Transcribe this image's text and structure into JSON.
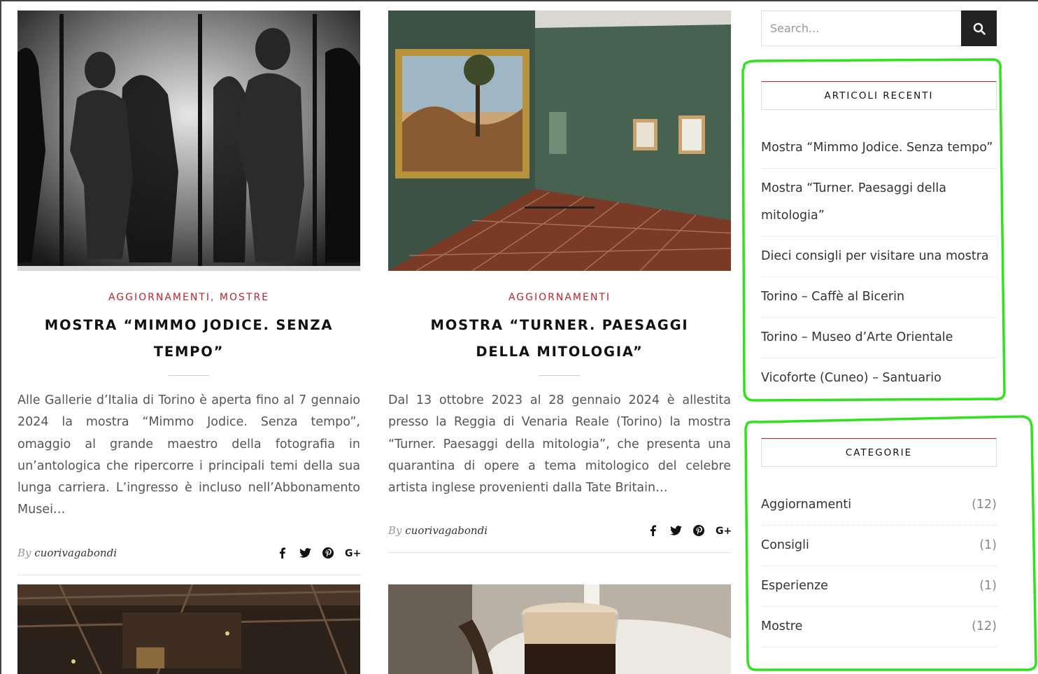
{
  "posts": [
    {
      "image_alt": "bronze-runners-photo",
      "categories": [
        "AGGIORNAMENTI",
        "MOSTRE"
      ],
      "category_separator": ",",
      "title": "MOSTRA “MIMMO JODICE. SENZA TEMPO”",
      "excerpt": "Alle Gallerie d’Italia di Torino è aperta fino al 7 gennaio 2024 la mostra “Mimmo Jodice. Senza tempo”, omaggio al grande maestro della fotografia in un’antologica che ripercorre i principali temi della sua lunga carriera. L’ingresso è incluso nell’Abbonamento Musei…",
      "by": "By",
      "author": "cuorivagabondi"
    },
    {
      "image_alt": "turner-gallery-photo",
      "categories": [
        "AGGIORNAMENTI"
      ],
      "category_separator": "",
      "title": "MOSTRA “TURNER. PAESAGGI DELLA MITOLOGIA”",
      "excerpt": "Dal 13 ottobre 2023 al 28 gennaio 2024 è allestita presso la Reggia di Venaria Reale (Torino) la mostra “Turner. Paesaggi della mitologia”, che presenta una quarantina di opere a tema mitologico del celebre artista inglese provenienti dalla Tate Britain…",
      "by": "By",
      "author": "cuorivagabondi"
    }
  ],
  "share_icons": [
    "facebook-icon",
    "twitter-icon",
    "pinterest-icon",
    "google-plus-icon"
  ],
  "search": {
    "placeholder": "Search..."
  },
  "recent": {
    "title": "ARTICOLI RECENTI",
    "items": [
      "Mostra “Mimmo Jodice. Senza tempo”",
      "Mostra “Turner. Paesaggi della mitologia”",
      "Dieci consigli per visitare una mostra",
      "Torino – Caffè al Bicerin",
      "Torino – Museo d’Arte Orientale",
      "Vicoforte (Cuneo) – Santuario"
    ]
  },
  "categories": {
    "title": "CATEGORIE",
    "items": [
      {
        "name": "Aggiornamenti",
        "count": "(12)"
      },
      {
        "name": "Consigli",
        "count": "(1)"
      },
      {
        "name": "Esperienze",
        "count": "(1)"
      },
      {
        "name": "Mostre",
        "count": "(12)"
      }
    ]
  },
  "colors": {
    "accent": "#c4222d",
    "annotation": "#2ee31a"
  }
}
